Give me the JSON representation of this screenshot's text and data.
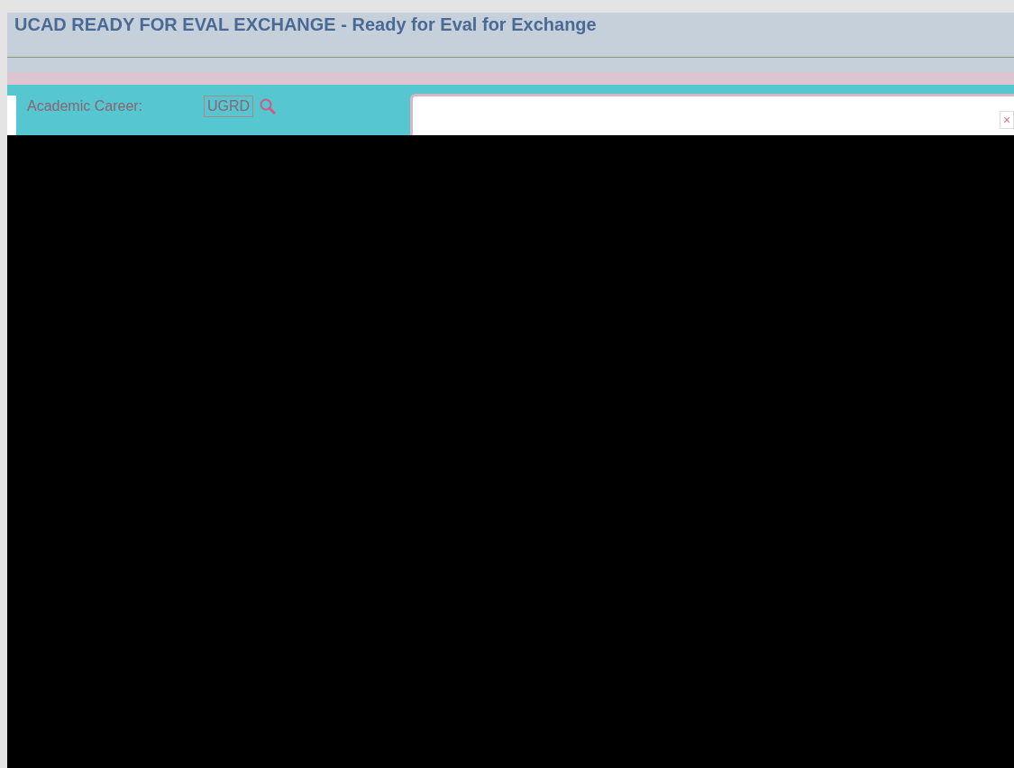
{
  "page": {
    "title": "UCAD READY FOR EVAL EXCHANGE - Ready for Eval for Exchange"
  },
  "fields": [
    {
      "label": "Academic Career:",
      "value": "UGRD"
    }
  ],
  "dialog": {
    "close": "×"
  }
}
